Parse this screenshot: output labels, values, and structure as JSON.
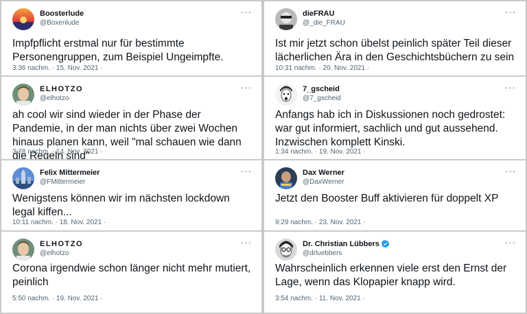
{
  "tweets": [
    {
      "name": "Boosterlude",
      "handle": "@Boxenlude",
      "text": "Impfpflicht erstmal nur für bestimmte Personengruppen, zum Beispiel Ungeimpfte.",
      "meta": "3:36 nachm. · 15. Nov. 2021 ·",
      "more": "···"
    },
    {
      "name": "dieFRAU",
      "handle": "@_die_FRAU",
      "text": "Ist mir jetzt schon übelst peinlich später Teil dieser lächerlichen Ära in den Geschichtsbüchern zu sein",
      "meta": "10:31 nachm. · 20. Nov. 2021 ·",
      "more": "···"
    },
    {
      "name": "ELHOTZO",
      "handle": "@elhotzo",
      "text": "ah cool wir sind wieder in der Phase der Pandemie, in der man nichts über zwei Wochen hinaus planen kann, weil \"mal schauen wie dann die Regeln sind\"",
      "meta": "3:28 nachm. · 14. Nov. 2021 ·",
      "more": "···"
    },
    {
      "name": "7_gscheid",
      "handle": "@7_gscheid",
      "text": "Anfangs hab ich in Diskussionen noch gedrostet: war gut informiert, sachlich und gut aussehend. Inzwischen komplett Kinski.",
      "meta": "1:34 nachm. · 19. Nov. 2021 ·",
      "more": "···"
    },
    {
      "name": "Felix Mittermeier",
      "handle": "@FMittermeier",
      "text": "Wenigstens können wir im nächsten lockdown legal kiffen...",
      "meta": "10:11 nachm. · 18. Nov. 2021 ·",
      "more": "···"
    },
    {
      "name": "Dax Werner",
      "handle": "@DaxWerner",
      "text": "Jetzt den Booster Buff aktivieren für doppelt XP",
      "meta": "9:29 nachm. · 23. Nov. 2021 ·",
      "more": "···"
    },
    {
      "name": "ELHOTZO",
      "handle": "@elhotzo",
      "text": "Corona irgendwie schon länger nicht mehr mutiert, peinlich",
      "meta": "5:50 nachm. · 19. Nov. 2021 ·",
      "more": "···"
    },
    {
      "name": "Dr. Christian Lübbers",
      "handle": "@drluebbers",
      "text": "Wahrscheinlich erkennen viele erst den Ernst der Lage, wenn das Klopapier knapp wird.",
      "meta": "3:54 nachm. · 11. Nov. 2021 ·",
      "more": "···"
    }
  ],
  "colors": {
    "text": "#0f1419",
    "secondary": "#536471",
    "verified": "#1d9bf0",
    "divider": "#c9c9c9"
  },
  "icons": {
    "more": "more-horizontal-icon",
    "verified": "verified-badge-icon"
  }
}
